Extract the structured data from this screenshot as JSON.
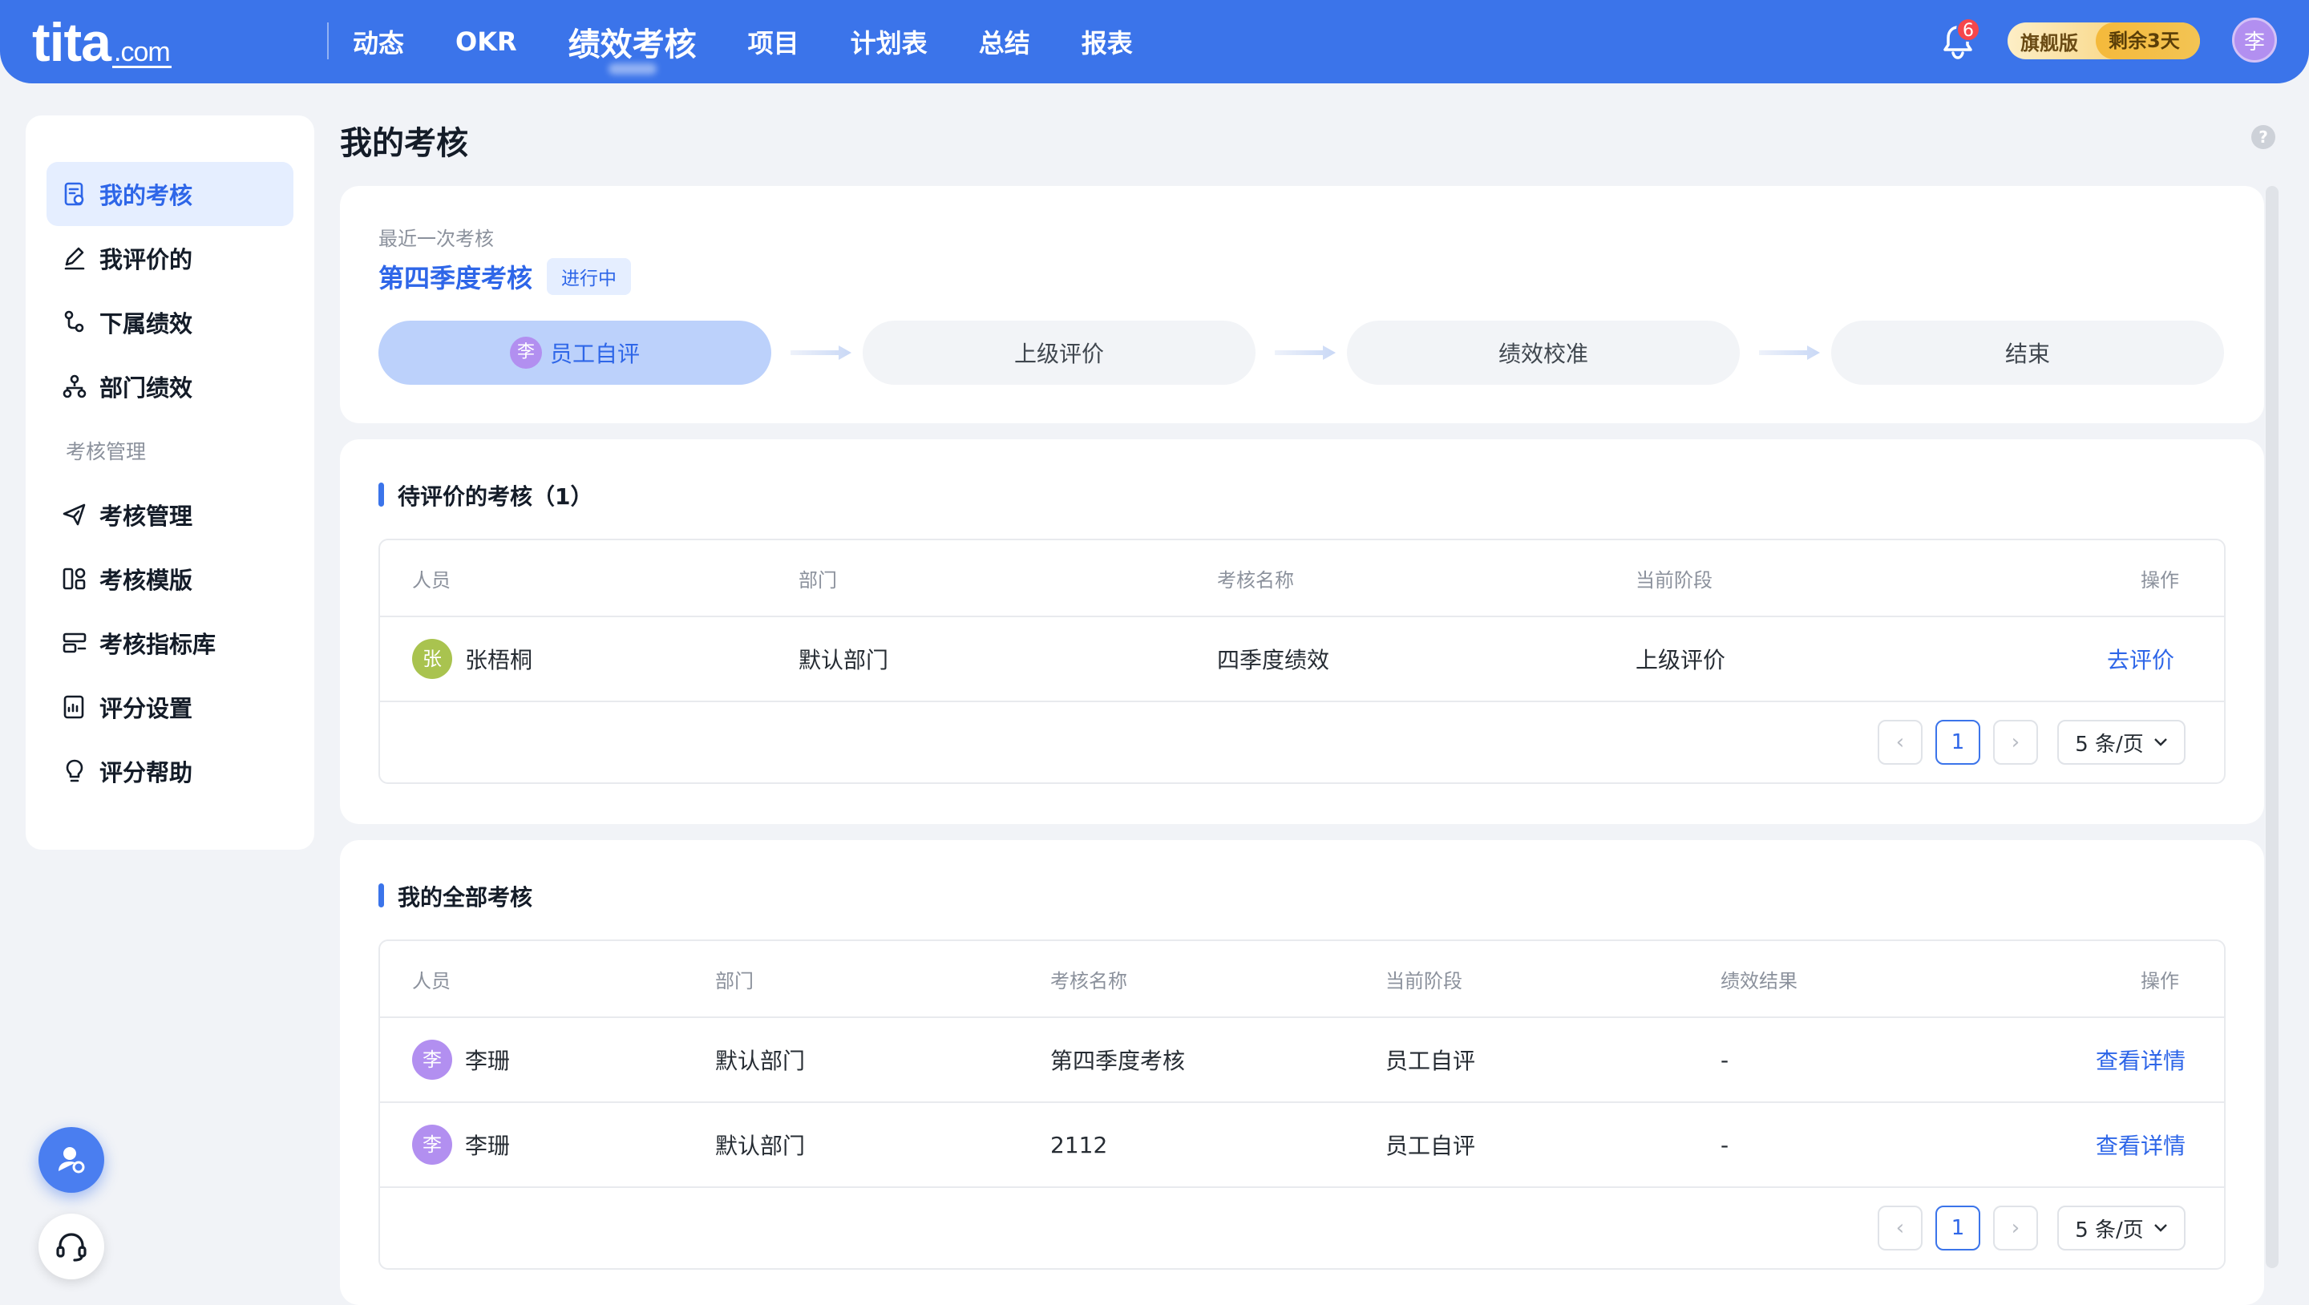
{
  "logo": {
    "main": "tita",
    "suffix": ".com"
  },
  "nav": {
    "items": [
      "动态",
      "OKR",
      "绩效考核",
      "项目",
      "计划表",
      "总结",
      "报表"
    ],
    "active_index": 2
  },
  "notifications": {
    "count": "6"
  },
  "plan": {
    "name": "旗舰版",
    "remaining": "剩余3天"
  },
  "user": {
    "avatar_char": "李"
  },
  "sidebar": {
    "items": [
      {
        "label": "我的考核"
      },
      {
        "label": "我评价的"
      },
      {
        "label": "下属绩效"
      },
      {
        "label": "部门绩效"
      }
    ],
    "section_label": "考核管理",
    "manage_items": [
      {
        "label": "考核管理"
      },
      {
        "label": "考核模版"
      },
      {
        "label": "考核指标库"
      },
      {
        "label": "评分设置"
      },
      {
        "label": "评分帮助"
      }
    ]
  },
  "page": {
    "title": "我的考核",
    "help_glyph": "?"
  },
  "recent": {
    "label": "最近一次考核",
    "title": "第四季度考核",
    "status": "进行中",
    "steps": [
      {
        "label": "员工自评",
        "avatar": "李",
        "active": true
      },
      {
        "label": "上级评价"
      },
      {
        "label": "绩效校准"
      },
      {
        "label": "结束"
      }
    ]
  },
  "pending": {
    "title": "待评价的考核（1）",
    "columns": [
      "人员",
      "部门",
      "考核名称",
      "当前阶段",
      "操作"
    ],
    "rows": [
      {
        "avatar": "张",
        "name": "张梧桐",
        "dept": "默认部门",
        "review": "四季度绩效",
        "stage": "上级评价",
        "action": "去评价"
      }
    ],
    "pager": {
      "page": "1",
      "size": "5 条/页",
      "prev": "‹",
      "next": "›"
    }
  },
  "all": {
    "title": "我的全部考核",
    "columns": [
      "人员",
      "部门",
      "考核名称",
      "当前阶段",
      "绩效结果",
      "操作"
    ],
    "rows": [
      {
        "avatar": "李",
        "name": "李珊",
        "dept": "默认部门",
        "review": "第四季度考核",
        "stage": "员工自评",
        "result": "-",
        "action": "查看详情"
      },
      {
        "avatar": "李",
        "name": "李珊",
        "dept": "默认部门",
        "review": "2112",
        "stage": "员工自评",
        "result": "-",
        "action": "查看详情"
      }
    ],
    "pager": {
      "page": "1",
      "size": "5 条/页",
      "prev": "‹",
      "next": "›"
    }
  },
  "colors": {
    "brand": "#3b74ea",
    "link": "#2e66e8",
    "avatar_purple": "#b28ff0",
    "avatar_green": "#a9c34f",
    "badge_red": "#f5474c"
  },
  "icons": {
    "sidebar": [
      "review-doc-icon",
      "edit-icon",
      "subordinate-icon",
      "org-tree-icon",
      "send-icon",
      "template-icon",
      "index-library-icon",
      "score-settings-icon",
      "bulb-icon"
    ],
    "float": [
      "user-settings-icon",
      "headset-icon"
    ]
  }
}
